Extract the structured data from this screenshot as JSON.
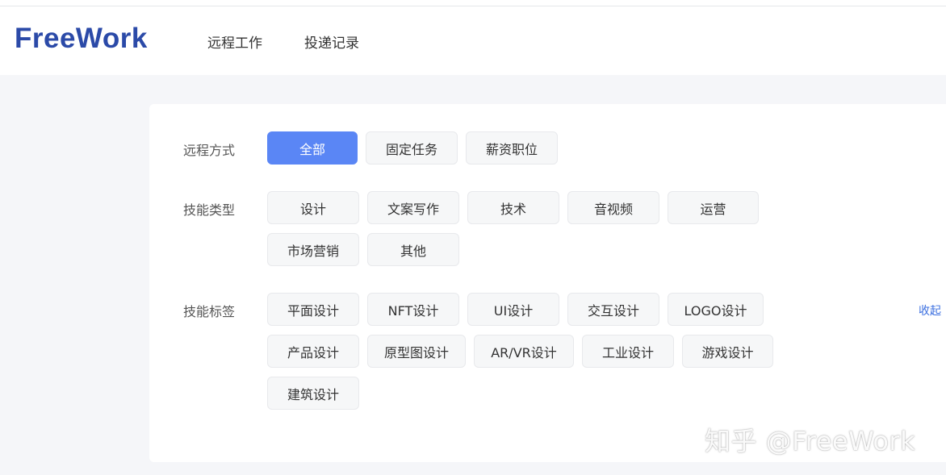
{
  "header": {
    "logo_text": "FreeWork",
    "nav": [
      "远程工作",
      "投递记录"
    ]
  },
  "filters": {
    "remote_mode": {
      "label": "远程方式",
      "options": [
        "全部",
        "固定任务",
        "薪资职位"
      ],
      "selected": "全部"
    },
    "skill_type": {
      "label": "技能类型",
      "options": [
        "设计",
        "文案写作",
        "技术",
        "音视频",
        "运营",
        "市场营销",
        "其他"
      ]
    },
    "skill_tags": {
      "label": "技能标签",
      "options": [
        "平面设计",
        "NFT设计",
        "UI设计",
        "交互设计",
        "LOGO设计",
        "产品设计",
        "原型图设计",
        "AR/VR设计",
        "工业设计",
        "游戏设计",
        "建筑设计"
      ],
      "collapse_label": "收起"
    }
  },
  "watermark": "知乎 @FreeWork",
  "colors": {
    "accent": "#5a86f5",
    "logo": "#2b4aa8",
    "link": "#3b6fe0"
  }
}
